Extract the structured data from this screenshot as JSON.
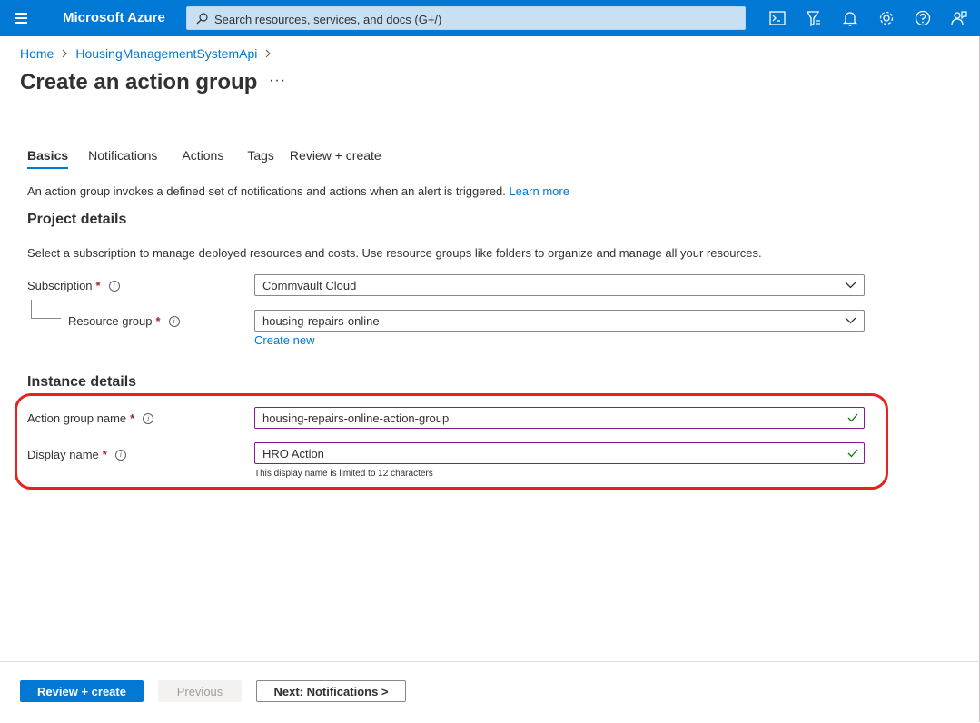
{
  "app": {
    "title": "Microsoft Azure",
    "search_placeholder": "Search resources, services, and docs (G+/)"
  },
  "breadcrumb": [
    {
      "label": "Home"
    },
    {
      "label": "HousingManagementSystemApi"
    }
  ],
  "page": {
    "title": "Create an action group",
    "more": "···"
  },
  "tabs": [
    {
      "label": "Basics",
      "active": true
    },
    {
      "label": "Notifications",
      "active": false
    },
    {
      "label": "Actions",
      "active": false
    },
    {
      "label": "Tags",
      "active": false
    },
    {
      "label": "Review + create",
      "active": false
    }
  ],
  "intro": {
    "text": "An action group invokes a defined set of notifications and actions when an alert is triggered.",
    "link": "Learn more"
  },
  "project": {
    "heading": "Project details",
    "description": "Select a subscription to manage deployed resources and costs. Use resource groups like folders to organize and manage all your resources.",
    "subscription_label": "Subscription",
    "subscription_value": "Commvault Cloud",
    "resource_group_label": "Resource group",
    "resource_group_value": "housing-repairs-online",
    "create_new": "Create new"
  },
  "instance": {
    "heading": "Instance details",
    "action_group_label": "Action group name",
    "action_group_value": "housing-repairs-online-action-group",
    "display_name_label": "Display name",
    "display_name_value": "HRO Action",
    "display_name_hint": "This display name is limited to 12 characters"
  },
  "required_marker": "*",
  "footer": {
    "review_create": "Review + create",
    "previous": "Previous",
    "next": "Next: Notifications >"
  },
  "colors": {
    "accent": "#0078d4",
    "highlight": "#e5231b",
    "valid": "#107c10"
  }
}
